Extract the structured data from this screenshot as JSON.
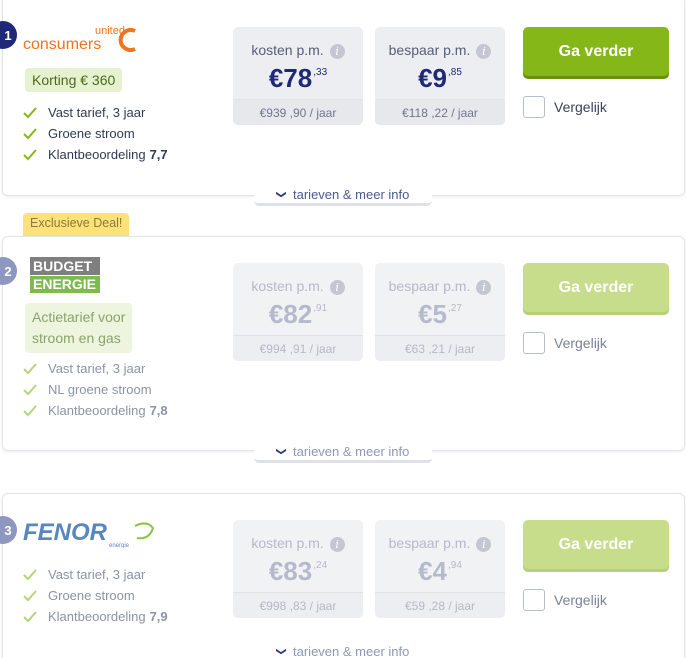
{
  "offers": [
    {
      "rank": "1",
      "provider": "united consumers",
      "logo_top": "united",
      "logo_main": "consumers",
      "discount": "Korting € 360",
      "features": [
        "Vast tarief, 3 jaar",
        "Groene stroom",
        "Klantbeoordeling"
      ],
      "rating": "7,7",
      "cost_label": "kosten p.m.",
      "cost_whole": "€78",
      "cost_cents": ",33",
      "cost_year": "€939 ,90 / jaar",
      "save_label": "bespaar p.m.",
      "save_whole": "€9",
      "save_cents": ",85",
      "save_year": "€118 ,22 / jaar",
      "cta": "Ga verder",
      "compare": "Vergelijk",
      "more": "tarieven & meer info"
    },
    {
      "rank": "2",
      "badge": "Exclusieve Deal!",
      "provider": "Budget Energie",
      "logo_top": "BUDGET",
      "logo_main": "ENERGIE",
      "discount_line1": "Actietarief voor",
      "discount_line2": "stroom en gas",
      "features": [
        "Vast tarief, 3 jaar",
        "NL groene stroom",
        "Klantbeoordeling"
      ],
      "rating": "7,8",
      "cost_label": "kosten p.m.",
      "cost_whole": "€82",
      "cost_cents": ",91",
      "cost_year": "€994 ,91 / jaar",
      "save_label": "bespaar p.m.",
      "save_whole": "€5",
      "save_cents": ",27",
      "save_year": "€63 ,21 / jaar",
      "cta": "Ga verder",
      "compare": "Vergelijk",
      "more": "tarieven & meer info"
    },
    {
      "rank": "3",
      "provider": "Fenor",
      "logo_main": "FENOR",
      "logo_sub": "energie",
      "features": [
        "Vast tarief, 3 jaar",
        "Groene stroom",
        "Klantbeoordeling"
      ],
      "rating": "7,9",
      "cost_label": "kosten p.m.",
      "cost_whole": "€83",
      "cost_cents": ",24",
      "cost_year": "€998 ,83 / jaar",
      "save_label": "bespaar p.m.",
      "save_whole": "€4",
      "save_cents": ",94",
      "save_year": "€59 ,28 / jaar",
      "cta": "Ga verder",
      "compare": "Vergelijk",
      "more": "tarieven & meer info"
    }
  ],
  "colors": {
    "brand_navy": "#1e2a78",
    "cta_green": "#86b718",
    "cta_green_faded": "#c7dd8c",
    "badge_yellow": "#fde27a",
    "united_orange": "#f0731e"
  },
  "info_icon": "i"
}
